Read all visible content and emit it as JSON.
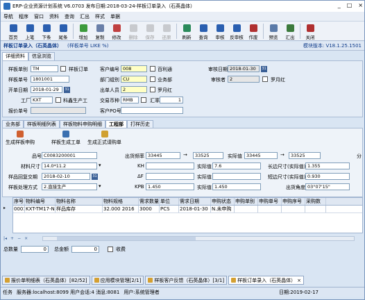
{
  "window": {
    "title": "ERP-企业资源计划系统 V6.0703 发布日期:2018-03-24-样板订单录入（石英晶体）",
    "controls": [
      "_",
      "□",
      "×"
    ]
  },
  "menu": [
    "导航",
    "程序",
    "窗口",
    "资料",
    "查询",
    "汇出",
    "样式",
    "单据"
  ],
  "toolbar": [
    {
      "label": "首页",
      "color": "#2a5fb0",
      "disabled": false
    },
    {
      "label": "上笔",
      "color": "#2a5fb0",
      "disabled": false
    },
    {
      "label": "下条",
      "color": "#2a5fb0",
      "disabled": false
    },
    {
      "label": "尾条",
      "color": "#2a5fb0",
      "disabled": false
    },
    {
      "label": "增加",
      "color": "#3c9a3c",
      "disabled": false
    },
    {
      "label": "复制",
      "color": "#6a7fa8",
      "disabled": false
    },
    {
      "label": "修改",
      "color": "#c04040",
      "disabled": false
    },
    {
      "label": "删除",
      "color": "#808080",
      "disabled": true
    },
    {
      "label": "保存",
      "color": "#808080",
      "disabled": true
    },
    {
      "label": "还原",
      "color": "#808080",
      "disabled": true
    },
    {
      "label": "刷新",
      "color": "#2a8a5a",
      "disabled": false
    },
    {
      "label": "查询",
      "color": "#2a5fb0",
      "disabled": false
    },
    {
      "label": "审核",
      "color": "#2a5fb0",
      "disabled": false
    },
    {
      "label": "反审核",
      "color": "#2a5fb0",
      "disabled": false
    },
    {
      "label": "作废",
      "color": "#b03030",
      "disabled": false
    },
    {
      "label": "预览",
      "color": "#5a7aa8",
      "disabled": false
    },
    {
      "label": "汇出",
      "color": "#3c7a3c",
      "disabled": false
    },
    {
      "label": "关闭",
      "color": "#b03030",
      "disabled": false
    }
  ],
  "form": {
    "title": "样板订单录入（石英晶体）",
    "filter": "(样板单号 LIKE %)",
    "version": "模块版本: V18.1.25.1501"
  },
  "subtabs": [
    "详细资料",
    "信息浏览"
  ],
  "header": {
    "sample_no_type_label": "样板单别",
    "sample_no_type_value": "TM",
    "sample_order_label": "样板订单",
    "sample_no_label": "样板单号",
    "sample_no_value": "1801001",
    "open_date_label": "开单日期",
    "open_date_value": "2018-01-29",
    "factory_label": "工厂",
    "factory_value": "KXT",
    "factory_name": "科鑫生产工",
    "quote_no_label": "报价单号",
    "customer_no_label": "客户编号",
    "customer_no_value": "008",
    "customer_name": "百利通",
    "dept_label": "部门组别",
    "dept_value": "CU",
    "dept_name": "业务部",
    "salesman_label": "出单人员",
    "salesman_value": "2",
    "salesman_name": "罗月红",
    "currency_label": "交易币种",
    "currency_value": "RMB",
    "rate_label": "汇率",
    "rate_value": "1",
    "customer_po_label": "客户PO号",
    "audit_date_label": "审核日期",
    "audit_date_value": "2018-01-30",
    "auditor_label": "审核者",
    "auditor_value": "2",
    "auditor_name": "罗月红"
  },
  "detail_tabs": [
    "业务部",
    "样板明细列表",
    "样板物料申购明细",
    "工程部",
    "打样历史"
  ],
  "actions": [
    "生成样板申购",
    "样板生成工单",
    "生成正式请购单"
  ],
  "detail": {
    "part_no_label": "品号",
    "part_no_value": "C0083200001",
    "material_size_label": "材料尺寸",
    "material_size_value": "14.0*11.2",
    "reply_date_label": "样品回复交期",
    "reply_date_value": "2018-02-10",
    "process_label": "样板处理方式",
    "process_value": "2.直接生产",
    "freq_label": "出货频率",
    "freq_value": "33445",
    "freq_to": "33525",
    "measured_label": "实际值",
    "measured_value": "33445",
    "measured_to": "33525",
    "kh_label": "KH",
    "kh_actual": "7.6",
    "df_label": "ΔF",
    "kpb_label": "KPB",
    "kpb_value": "1.450",
    "kpb_actual": "1.450",
    "length_label": "长边尺寸(实际值)",
    "length_value": "1.355",
    "short_label": "短边尺寸(实际值)",
    "short_value": "0.930",
    "angle_label": "出货角度",
    "angle_value": "03°07'15\"",
    "actual_label": "实际值",
    "arrow": "→",
    "fen": "分"
  },
  "grid": {
    "headers": [
      "序号",
      "物料编号",
      "物料名称",
      "物料规格",
      "需求数量",
      "单位",
      "需求日期",
      "申购状态",
      "申购单别",
      "申购单号",
      "申购序号",
      "采购数"
    ],
    "rows": [
      [
        "0001",
        "KXT-TM17-N2",
        "样品库存",
        "32.000 2016",
        "3000",
        "PCS",
        "2018-01-30",
        "N.未申购",
        "",
        "",
        "",
        ""
      ]
    ]
  },
  "summary": {
    "total_qty_label": "总数量",
    "total_qty": "0",
    "total_amount_label": "总金额",
    "total_amount": "0",
    "tax_label": "收费"
  },
  "tasks": [
    "报价单明细表（石英晶体）[82/52]",
    "应用模块管理[2/1]",
    "样板客户反馈（石英晶体）[3/1]",
    "样板订单录入（石英晶体）"
  ],
  "status": {
    "task": "任务",
    "server": "服务器:localhost:8099 用户会话:4 消息:8081",
    "user": "用户:系统管理者",
    "date": "日期:2019-02-17"
  }
}
